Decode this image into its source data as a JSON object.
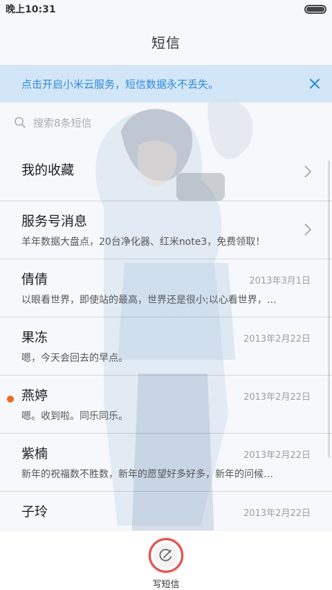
{
  "status_bar": {
    "time": "晚上10:31",
    "battery_level": 1.0
  },
  "header": {
    "title": "短信"
  },
  "banner": {
    "text": "点击开启小米云服务，短信数据永不丢失。",
    "close_icon": "close-icon"
  },
  "search": {
    "placeholder": "搜索8条短信",
    "icon": "search-icon"
  },
  "conversations": [
    {
      "name": "我的收藏",
      "preview": "",
      "date": "",
      "chevron": true,
      "unread": false
    },
    {
      "name": "服务号消息",
      "preview": "羊年数据大盘点，20台净化器、红米note3，免费领取！",
      "date": "",
      "chevron": true,
      "unread": false
    },
    {
      "name": "倩倩",
      "preview": "以眼看世界，即使站的最高，世界还是很小;以心看世界，…",
      "date": "2013年3月1日",
      "chevron": false,
      "unread": false
    },
    {
      "name": "果冻",
      "preview": "嗯，今天会回去的早点。",
      "date": "2013年2月22日",
      "chevron": false,
      "unread": false
    },
    {
      "name": "燕婷",
      "preview": "嗯。收到啦。同乐同乐。",
      "date": "2013年2月22日",
      "chevron": false,
      "unread": true
    },
    {
      "name": "紫楠",
      "preview": "新年的祝福数不胜数，新年的愿望好多好多，新年的问候…",
      "date": "2013年2月22日",
      "chevron": false,
      "unread": false
    },
    {
      "name": "子玲",
      "preview": "",
      "date": "2013年2月22日",
      "chevron": false,
      "unread": false
    }
  ],
  "compose": {
    "label": "写短信",
    "icon": "compose-icon"
  },
  "colors": {
    "accent": "#2f8ad8",
    "unread": "#f26a22",
    "compose_ring": "#e24d4d",
    "banner_bg": "#cee2f6"
  }
}
